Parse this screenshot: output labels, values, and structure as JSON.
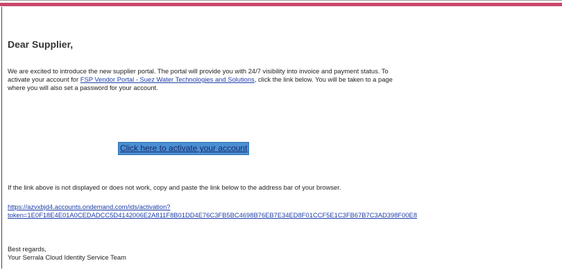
{
  "colors": {
    "accent_bar": "#c8476a",
    "link": "#1f3ea8",
    "button_bg": "#4a8fd4",
    "text": "#222222"
  },
  "email": {
    "greeting": "Dear Supplier,",
    "intro": {
      "before_link": "We are excited to introduce the new supplier portal. The portal will provide you with 24/7 visibility into invoice and payment status. To activate your account for ",
      "portal_link": "FSP Vendor Portal - Suez Water Technologies and Solutions",
      "after_link": ", click the link below. You will be taken to a page where you will also set a password for your account."
    },
    "cta_label": "Click here to activate your account",
    "help_text": "If the link above is not displayed or does not work, copy and paste the link below to the address bar of your browser.",
    "activation_link": {
      "line1": "https://azvxbjd4.accounts.ondemand.com/ids/activation?",
      "line2": "token=1E0F18E4E01A0CEDADCC5D4142006E2A811F8B01DD4E76C3FB5BC4698B76EB7E34ED8F01CCF5E1C3FB67B7C3AD398F00E8"
    },
    "signoff": {
      "closing": "Best regards,",
      "team": "Your Serrala Cloud Identity Service Team"
    }
  }
}
